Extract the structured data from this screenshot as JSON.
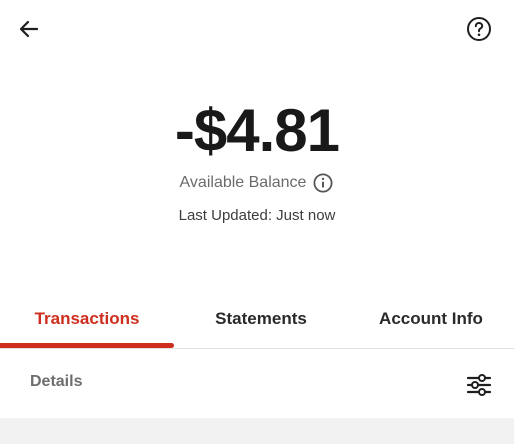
{
  "header": {
    "back_icon": "arrow-left-icon",
    "help_icon": "question-circle-icon"
  },
  "balance": {
    "amount": "-$4.81",
    "label": "Available Balance",
    "info_icon": "info-circle-icon",
    "last_updated": "Last Updated: Just now"
  },
  "tabs": [
    {
      "label": "Transactions",
      "active": true
    },
    {
      "label": "Statements",
      "active": false
    },
    {
      "label": "Account Info",
      "active": false
    }
  ],
  "details": {
    "label": "Details",
    "filter_icon": "sliders-icon"
  },
  "colors": {
    "accent": "#cf2e1e",
    "text": "#191919",
    "muted": "#6b6b6b"
  }
}
